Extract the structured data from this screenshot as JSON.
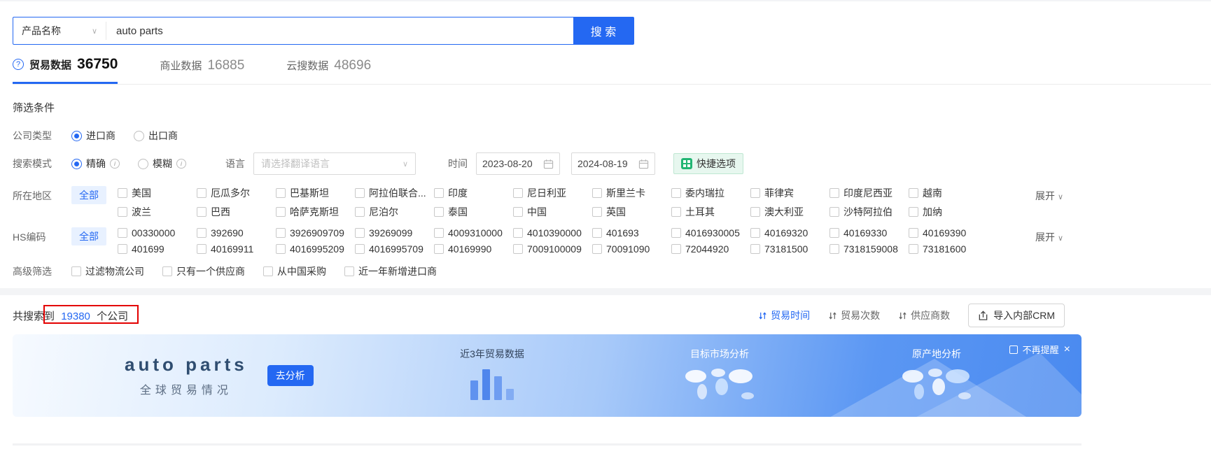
{
  "icons": {
    "chevron_down": "∨",
    "question": "?",
    "close": "×",
    "info": "i"
  },
  "colors": {
    "accent": "#2468f2",
    "green": "#22b573",
    "annotation": "#e30000"
  },
  "search": {
    "category": "产品名称",
    "query": "auto parts",
    "button": "搜 索"
  },
  "tabs": [
    {
      "label": "贸易数据",
      "count": "36750",
      "active": true
    },
    {
      "label": "商业数据",
      "count": "16885",
      "active": false
    },
    {
      "label": "云搜数据",
      "count": "48696",
      "active": false
    }
  ],
  "filters": {
    "title": "筛选条件",
    "company_type": {
      "label": "公司类型",
      "options": [
        "进口商",
        "出口商"
      ],
      "selected": "进口商"
    },
    "search_mode": {
      "label": "搜索模式",
      "options": [
        "精确",
        "模糊"
      ],
      "selected": "精确"
    },
    "language": {
      "label": "语言",
      "placeholder": "请选择翻译语言"
    },
    "time": {
      "label": "时间",
      "start": "2023-08-20",
      "end": "2024-08-19"
    },
    "quick_button": "快捷选项",
    "region": {
      "label": "所在地区",
      "all": "全部",
      "expand": "展开",
      "row1": [
        "美国",
        "厄瓜多尔",
        "巴基斯坦",
        "阿拉伯联合...",
        "印度",
        "尼日利亚",
        "斯里兰卡",
        "委内瑞拉",
        "菲律宾",
        "印度尼西亚",
        "越南"
      ],
      "row2": [
        "波兰",
        "巴西",
        "哈萨克斯坦",
        "尼泊尔",
        "泰国",
        "中国",
        "英国",
        "土耳其",
        "澳大利亚",
        "沙特阿拉伯",
        "加纳"
      ]
    },
    "hscode": {
      "label": "HS编码",
      "all": "全部",
      "expand": "展开",
      "row1": [
        "00330000",
        "392690",
        "3926909709",
        "39269099",
        "4009310000",
        "4010390000",
        "401693",
        "4016930005",
        "40169320",
        "40169330",
        "40169390"
      ],
      "row2": [
        "401699",
        "40169911",
        "4016995209",
        "4016995709",
        "40169990",
        "7009100009",
        "70091090",
        "72044920",
        "73181500",
        "7318159008",
        "73181600"
      ]
    },
    "advanced": {
      "label": "高级筛选",
      "options": [
        "过滤物流公司",
        "只有一个供应商",
        "从中国采购",
        "近一年新增进口商"
      ]
    }
  },
  "results": {
    "prefix": "共搜索到",
    "count": "19380",
    "suffix": "个公司",
    "sorts": [
      {
        "label": "贸易时间",
        "active": true
      },
      {
        "label": "贸易次数",
        "active": false
      },
      {
        "label": "供应商数",
        "active": false
      }
    ],
    "crm_button": "导入内部CRM"
  },
  "banner": {
    "title": "auto parts",
    "subtitle": "全球贸易情况",
    "analyze_button": "去分析",
    "chart_title": "近3年贸易数据",
    "map1_title": "目标市场分析",
    "map2_title": "原产地分析",
    "dismiss": "不再提醒",
    "chart_bars": [
      28,
      44,
      34,
      16
    ]
  }
}
